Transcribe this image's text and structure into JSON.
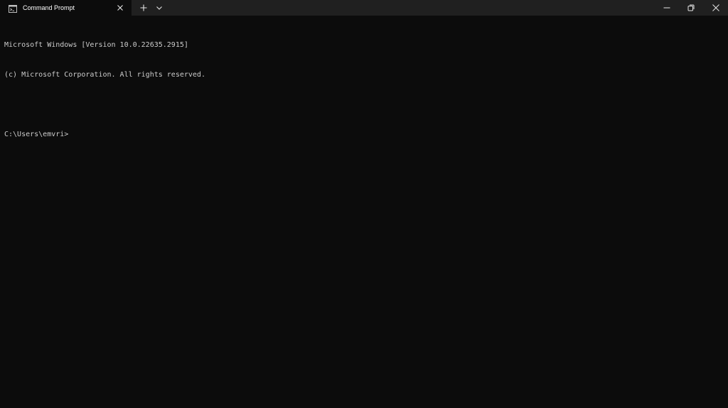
{
  "window": {
    "background": "#0c0c0c",
    "titlebar_color": "#202020"
  },
  "tab": {
    "title": "Command Prompt",
    "icon": "command-prompt-icon",
    "close_icon": "close-icon"
  },
  "tab_actions": {
    "new_tab_icon": "plus-icon",
    "dropdown_icon": "chevron-down-icon"
  },
  "window_controls": {
    "minimize_icon": "minimize-icon",
    "restore_icon": "restore-icon",
    "close_icon": "close-icon"
  },
  "terminal": {
    "text_color": "#cccccc",
    "lines": [
      "Microsoft Windows [Version 10.0.22635.2915]",
      "(c) Microsoft Corporation. All rights reserved.",
      "",
      "C:\\Users\\emvri>"
    ]
  }
}
